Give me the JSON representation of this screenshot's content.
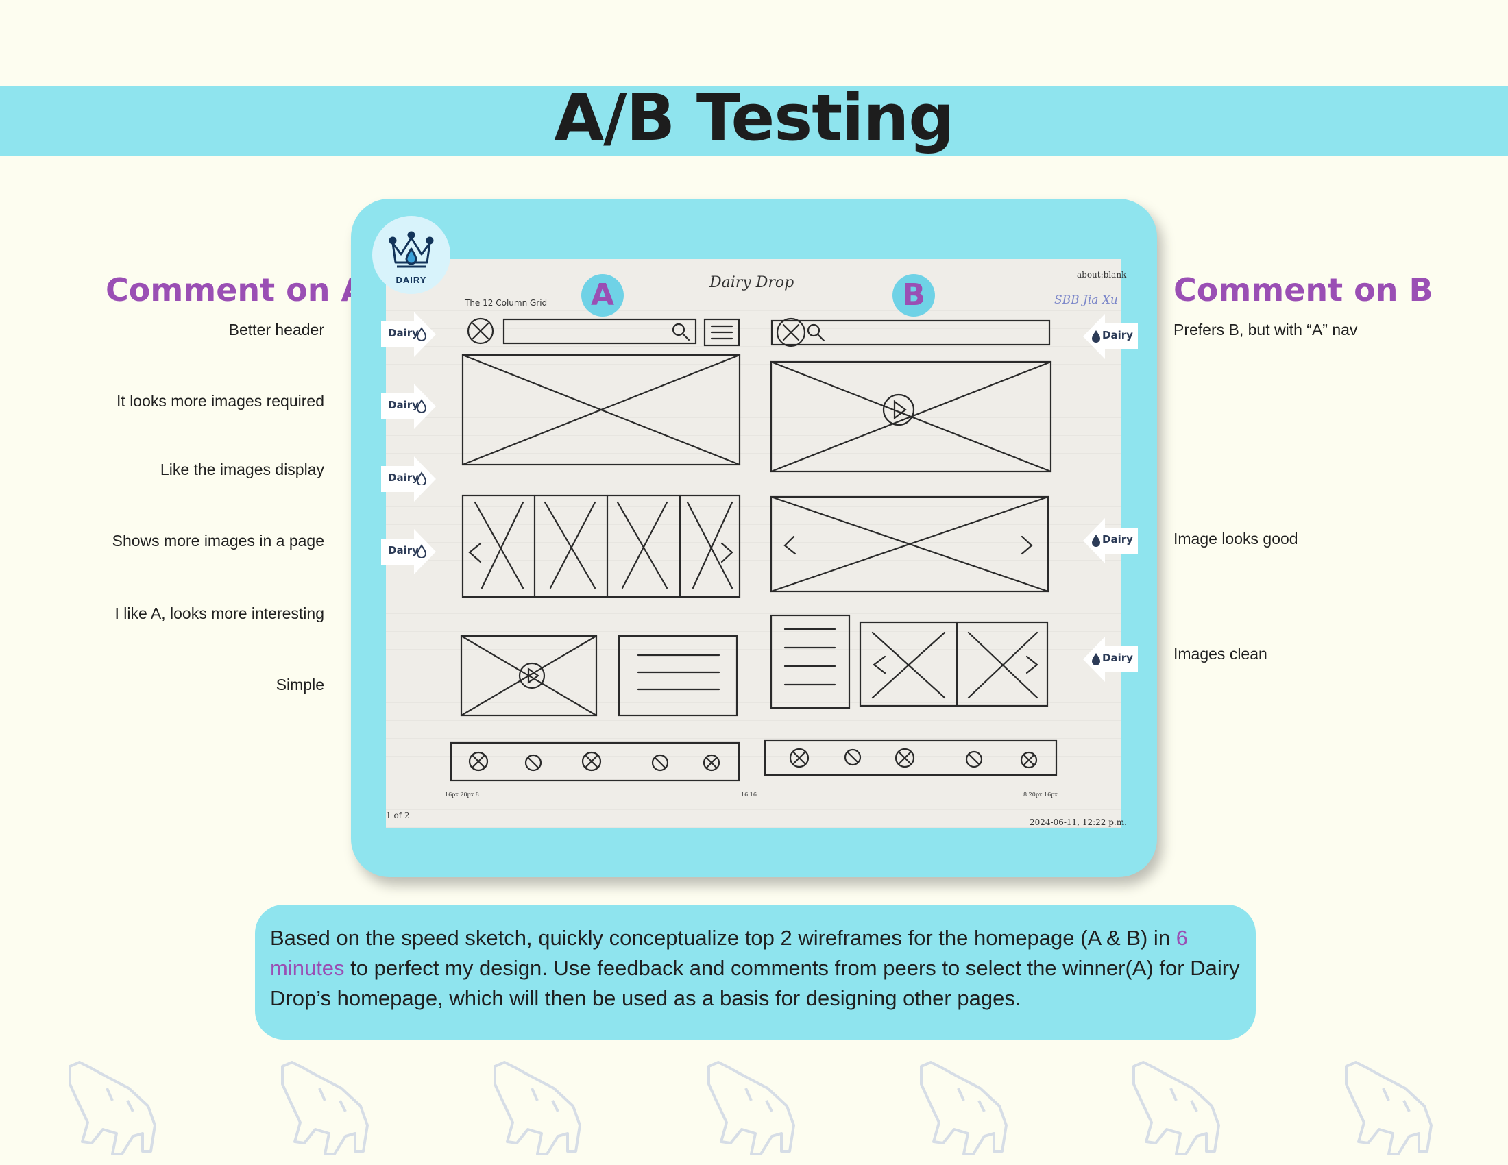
{
  "page": {
    "title": "A/B Testing"
  },
  "comments_a": {
    "heading": "Comment on A",
    "items": [
      "Better header",
      "It looks more images required",
      "Like the images display",
      "Shows more images in a page",
      "I like A, looks more interesting",
      "Simple"
    ]
  },
  "comments_b": {
    "heading": "Comment on B",
    "items": [
      "Prefers B, but with “A” nav",
      "Image looks good",
      "Images clean"
    ]
  },
  "sketch": {
    "logo_text": "DAIRY",
    "badge_a": "A",
    "badge_b": "B",
    "marker_label": "Dairy",
    "header_text": "Dairy Drop",
    "grid_label": "The 12 Column Grid",
    "browser_text": "about:blank",
    "initials": "SBB  Jia Xu",
    "page_count": "1 of 2",
    "timestamp": "2024-06-11, 12:22 p.m.",
    "note_left": "16px 20px  8",
    "note_mid": "16    16",
    "note_right": "8  20px  16px"
  },
  "caption": {
    "part1": "Based on the speed sketch, quickly conceptualize top 2 wireframes for the homepage (A & B) in ",
    "highlight": "6 minutes",
    "part2": " to perfect my design. Use feedback and comments from peers to select the winner(A) for Dairy Drop’s homepage, which will then be used as a basis for designing other pages."
  },
  "colors": {
    "background": "#fdfdf0",
    "band": "#8fe4ee",
    "accent": "#9a4fb4",
    "cow_outline": "#d6dde6"
  },
  "icons": {
    "logo": "crown-drop-icon",
    "marker": "arrow-marker-icon",
    "watermark": "cow-icon"
  }
}
